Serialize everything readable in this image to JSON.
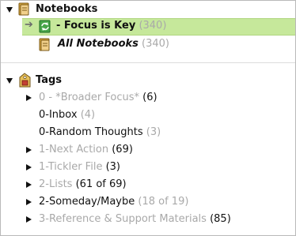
{
  "notebooks": {
    "header": "Notebooks",
    "items": [
      {
        "label": "- Focus is Key",
        "count": "(340)"
      },
      {
        "label": "All Notebooks",
        "count": "(340)"
      }
    ]
  },
  "tags": {
    "header": "Tags",
    "items": [
      {
        "label": "0 - *Broader Focus*",
        "count": "(6)"
      },
      {
        "label": "0-Inbox",
        "count": "(4)"
      },
      {
        "label": "0-Random Thoughts",
        "count": "(3)"
      },
      {
        "label": "1-Next Action",
        "count": "(69)"
      },
      {
        "label": "1-Tickler File",
        "count": "(3)"
      },
      {
        "label": "2-Lists",
        "count": "(61 of 69)"
      },
      {
        "label": "2-Someday/Maybe",
        "count": "(18 of 19)"
      },
      {
        "label": "3-Reference & Support Materials",
        "count": "(85)"
      }
    ]
  },
  "colors": {
    "selected_bg": "#c6e89b",
    "muted_text": "#a9a9a9",
    "notebook_icon": "#d9a83c"
  }
}
